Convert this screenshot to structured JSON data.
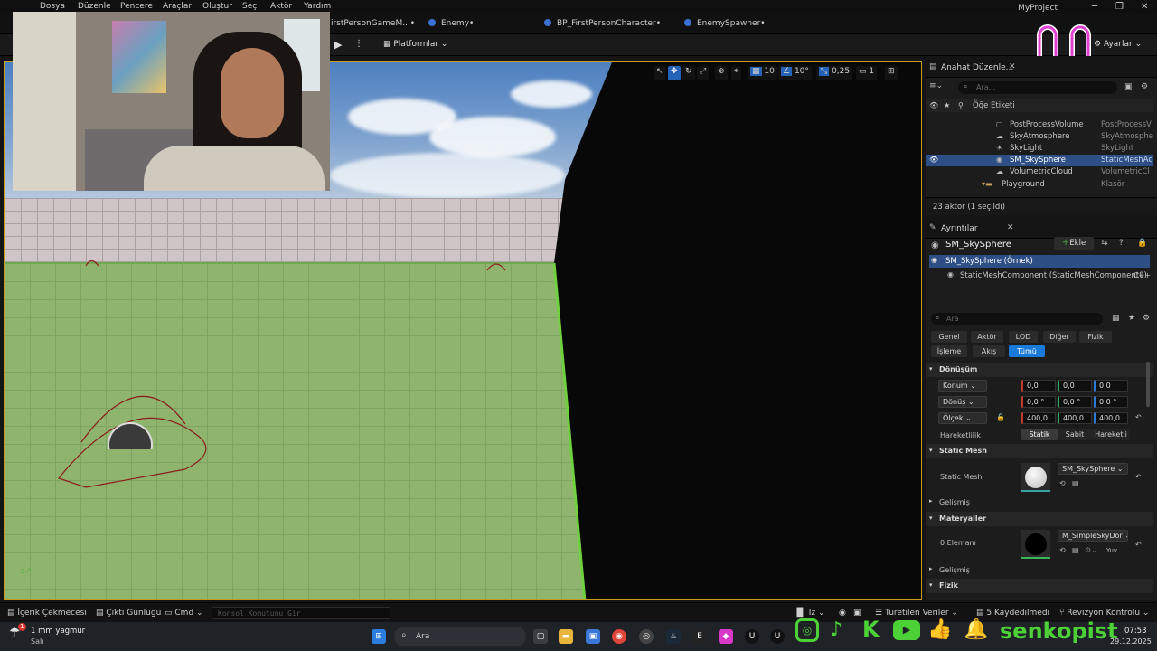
{
  "menu": {
    "items": [
      "Dosya",
      "Düzenle",
      "Pencere",
      "Araçlar",
      "Oluştur",
      "Seç",
      "Aktör",
      "Yardım"
    ]
  },
  "document_tabs": [
    {
      "label": "irstPersonGameM...•"
    },
    {
      "label": "Enemy•"
    },
    {
      "label": "BP_FirstPersonCharacter•"
    },
    {
      "label": "EnemySpawner•"
    }
  ],
  "project_name": "MyProject",
  "toolbar": {
    "platforms_label": "Platformlar",
    "settings_label": "Ayarlar"
  },
  "viewport_toolbar": {
    "grid_snap": "10",
    "rotation_snap": "10°",
    "scale_snap": "0,25",
    "camera_speed": "1"
  },
  "outliner": {
    "tab_title": "Anahat Düzenle...",
    "search_placeholder": "Ara...",
    "column_label": "Öğe Etiketi",
    "rows": [
      {
        "name": "PostProcessVolume",
        "type": "PostProcessV",
        "icon": "cube-icon"
      },
      {
        "name": "SkyAtmosphere",
        "type": "SkyAtmosphe",
        "icon": "cloud-icon"
      },
      {
        "name": "SkyLight",
        "type": "SkyLight",
        "icon": "light-icon"
      },
      {
        "name": "SM_SkySphere",
        "type": "StaticMeshAc",
        "icon": "mesh-icon",
        "selected": true
      },
      {
        "name": "VolumetricCloud",
        "type": "VolumetricCl",
        "icon": "cloud-icon"
      },
      {
        "name": "Playground",
        "type": "Klasör",
        "icon": "folder-icon"
      }
    ],
    "footer": "23 aktör (1 seçildi)"
  },
  "details": {
    "tab_title": "Ayrıntılar",
    "actor_name": "SM_SkySphere",
    "add_button": "Ekle",
    "instance_label": "SM_SkySphere (Örnek)",
    "component_label": "StaticMeshComponent (StaticMeshComponent0)",
    "component_suffix": "C++",
    "search_placeholder": "Ara",
    "filters_row1": [
      "Genel",
      "Aktör",
      "LOD",
      "Diğer",
      "Fizik"
    ],
    "filters_row2": [
      "İşleme",
      "Akış",
      "Tümü"
    ],
    "active_filter": "Tümü",
    "transform": {
      "header": "Dönüşüm",
      "location_label": "Konum",
      "location": [
        "0,0",
        "0,0",
        "0,0"
      ],
      "rotation_label": "Dönüş",
      "rotation": [
        "0,0 °",
        "0,0 °",
        "0,0 °"
      ],
      "scale_label": "Ölçek",
      "scale": [
        "400,0",
        "400,0",
        "400,0"
      ],
      "mobility_label": "Hareketlilik",
      "mobility_options": [
        "Statik",
        "Sabit",
        "Hareketli"
      ],
      "mobility_selected": "Statik"
    },
    "static_mesh": {
      "header": "Static Mesh",
      "label": "Static Mesh",
      "value": "SM_SkySphere",
      "advanced": "Gelişmiş"
    },
    "materials": {
      "header": "Materyaller",
      "element_label": "0 Elemanı",
      "value": "M_SimpleSkyDor",
      "extra": "Yuv",
      "advanced": "Gelişmiş"
    },
    "physics_header": "Fizik"
  },
  "statusbar": {
    "content_drawer": "İçerik Çekmecesi",
    "output_log": "Çıktı Günlüğü",
    "cmd": "Cmd",
    "console_placeholder": "Konsol Komutunu Gir",
    "derived_data": "Türetilen Veriler",
    "saved": "5 Kaydedilmedi",
    "revision": "Revizyon Kontrolü"
  },
  "taskbar": {
    "weather_line1": "1 mm yağmur",
    "weather_line2": "Salı",
    "search_placeholder": "Ara",
    "time": "07:53",
    "date": "29.12.2025",
    "notification_badge": "1"
  },
  "overlay": {
    "channel_name": "senkopist"
  },
  "colors": {
    "accent_blue": "#2563b8",
    "selection": "#2d4f85",
    "brand_green": "#4cd137",
    "logo_pink": "#e040d0"
  }
}
